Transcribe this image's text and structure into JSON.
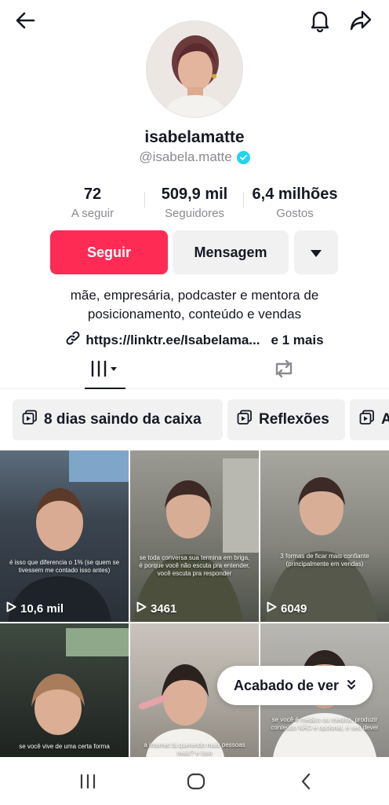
{
  "profile": {
    "username": "isabelamatte",
    "handle": "@isabela.matte",
    "verified": true
  },
  "stats": [
    {
      "value": "72",
      "label": "A seguir"
    },
    {
      "value": "509,9 mil",
      "label": "Seguidores"
    },
    {
      "value": "6,4 milhões",
      "label": "Gostos"
    }
  ],
  "actions": {
    "follow_label": "Seguir",
    "message_label": "Mensagem",
    "more_icon": "caret-down-icon"
  },
  "bio": {
    "line1": "mãe, empresária, podcaster e mentora de",
    "line2": "posicionamento, conteúdo e vendas",
    "link": "https://linktr.ee/Isabelama...",
    "link_more": "e 1 mais"
  },
  "tabs": [
    {
      "icon": "grid-icon",
      "active": true
    },
    {
      "icon": "repost-icon",
      "active": false
    }
  ],
  "playlists": [
    {
      "label": "8 dias saindo da caixa"
    },
    {
      "label": "Reflexões"
    },
    {
      "label": "A"
    }
  ],
  "videos": [
    {
      "views": "10,6 mil",
      "caption": "é isso que diferencia o 1% (se quem se tivessem me contado isso antes)"
    },
    {
      "views": "3461",
      "caption": "se toda conversa sua termina em briga, é porque você não escuta pra entender, você escuta pra responder"
    },
    {
      "views": "6049",
      "caption": "3 formas de ficar mais confiante (principalmente em vendas)"
    },
    {
      "views": "",
      "caption": "se você vive de uma certa forma"
    },
    {
      "views": "",
      "caption": "a internet tá querendo mais pessoas reais? e isso"
    },
    {
      "views": "",
      "caption": "se você é médico ou médica, produzir conteúdo NÃO é opcional, é seu dever"
    }
  ],
  "toast": {
    "label": "Acabado de ver"
  },
  "colors": {
    "accent": "#fe2c55",
    "verified": "#20d5ec",
    "secondary_text": "#8a8b91"
  }
}
